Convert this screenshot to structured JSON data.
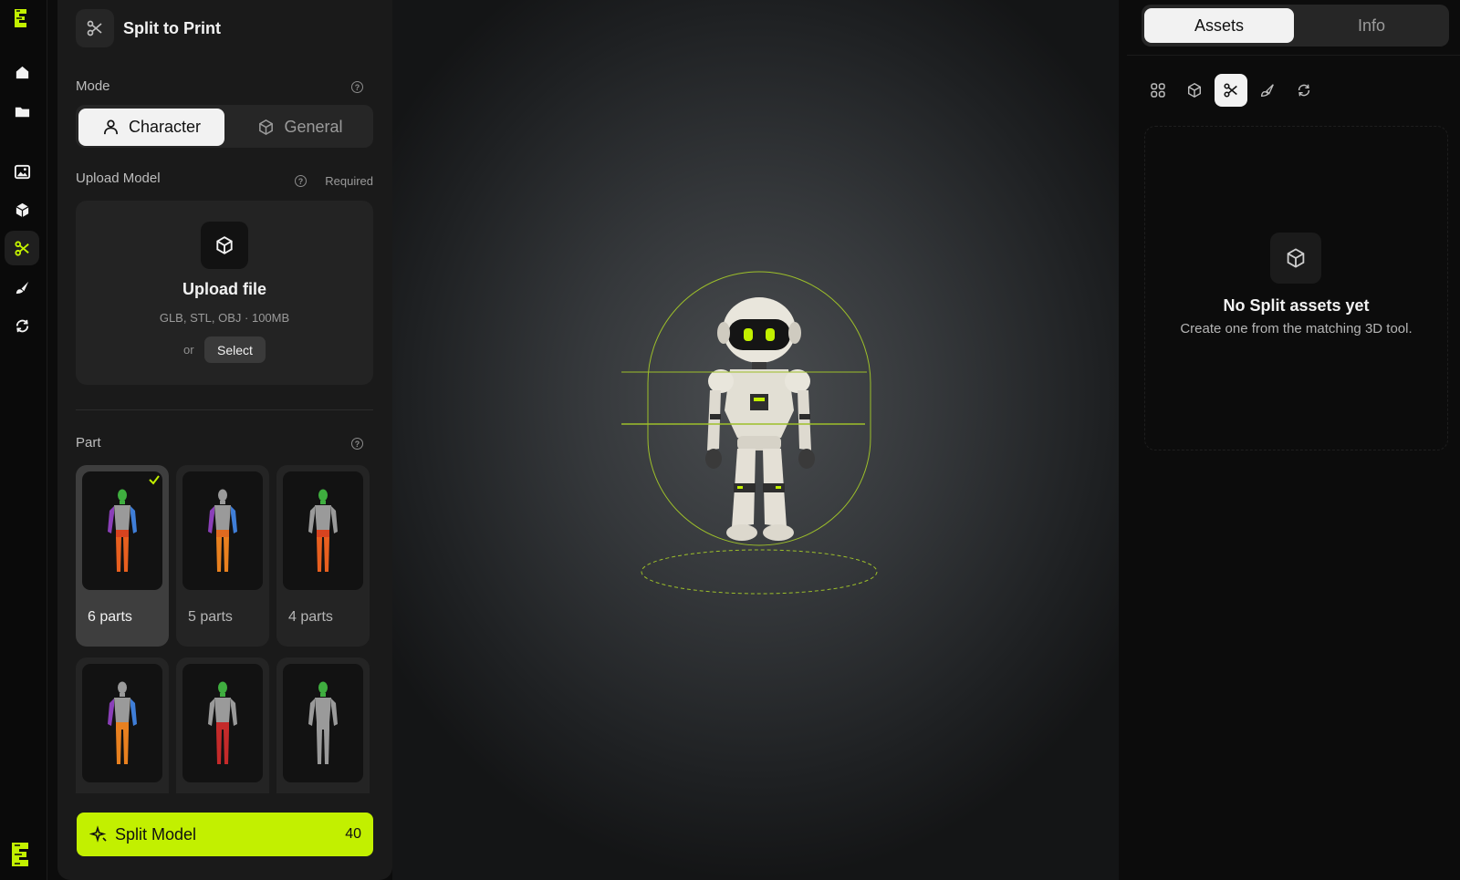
{
  "colors": {
    "accent": "#c2f000",
    "panel": "#1a1a1a",
    "selected_tab": "#f2f2f2"
  },
  "rail": {
    "items": [
      {
        "icon": "home-icon"
      },
      {
        "icon": "folder-icon"
      },
      {
        "icon": "image-icon"
      },
      {
        "icon": "cube-icon"
      },
      {
        "icon": "split-icon",
        "active": true
      },
      {
        "icon": "brush-icon"
      },
      {
        "icon": "refresh-icon"
      }
    ]
  },
  "panel": {
    "title": "Split to Print",
    "mode": {
      "label": "Mode",
      "options": [
        "Character",
        "General"
      ],
      "selected": "Character"
    },
    "upload": {
      "label": "Upload Model",
      "required": "Required",
      "title": "Upload file",
      "formats": "GLB, STL, OBJ · 100MB",
      "or": "or",
      "select": "Select"
    },
    "part": {
      "label": "Part",
      "options": [
        {
          "label": "6 parts",
          "selected": true
        },
        {
          "label": "5 parts"
        },
        {
          "label": "4 parts"
        },
        {
          "label": ""
        },
        {
          "label": ""
        },
        {
          "label": ""
        }
      ]
    },
    "split": {
      "label": "Split Model",
      "cost": "40"
    }
  },
  "rpanel": {
    "tabs": [
      "Assets",
      "Info"
    ],
    "active_tab": "Assets",
    "filters": [
      "grid-icon",
      "cube-icon",
      "split-icon",
      "brush-icon",
      "refresh-icon"
    ],
    "active_filter": "split-icon",
    "empty": {
      "title": "No Split assets yet",
      "subtitle": "Create one from the matching 3D tool."
    }
  }
}
